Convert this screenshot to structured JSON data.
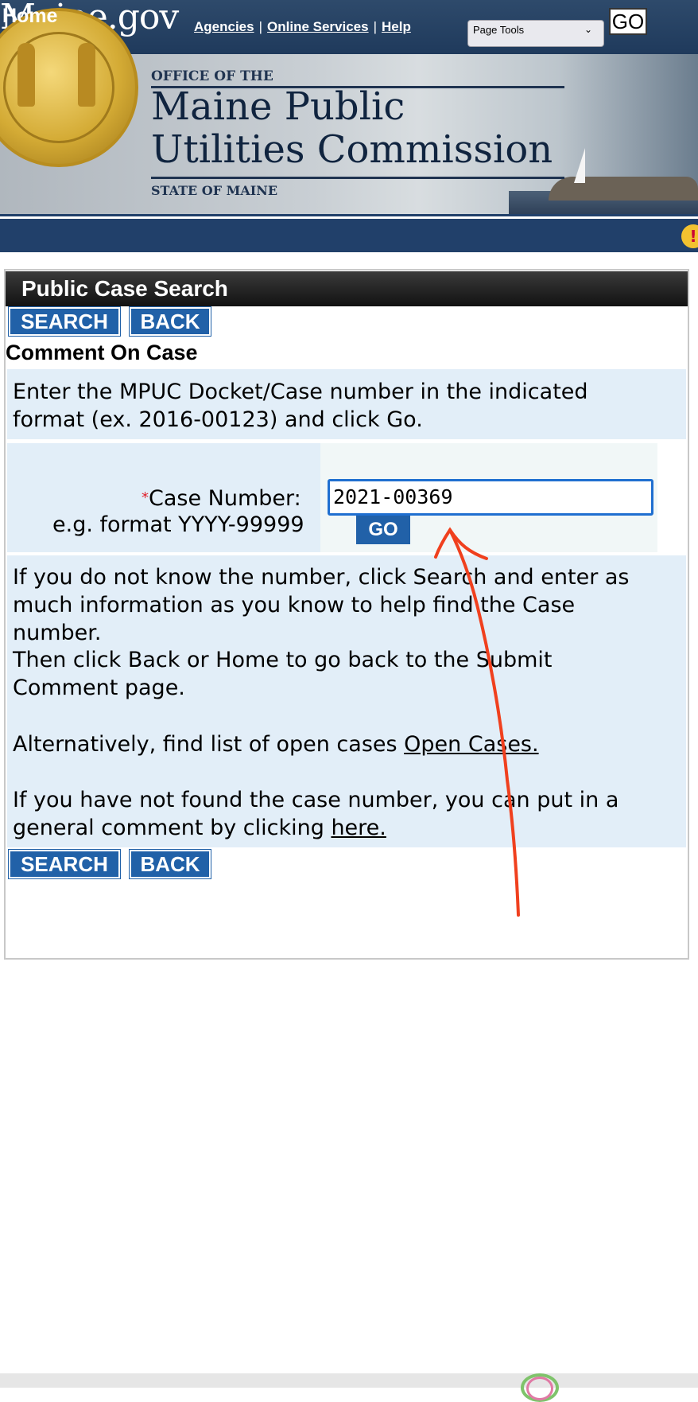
{
  "header": {
    "logo": "Maine.gov",
    "links": [
      "Agencies",
      "Online Services",
      "Help"
    ],
    "page_tools_value": "Page Tools",
    "go_label": "GO"
  },
  "banner": {
    "office_line": "OFFICE OF THE",
    "title_line1": "Maine Public",
    "title_line2": "Utilities Commission",
    "state_line": "STATE OF MAINE"
  },
  "nav": {
    "home": "Home"
  },
  "panel": {
    "title": "Public Case Search",
    "search_label": "SEARCH",
    "back_label": "BACK",
    "subtitle": "Comment On Case",
    "instructions_line1": "Enter the MPUC Docket/Case number in the indicated",
    "instructions_line2": "format (ex. 2016-00123) and click Go.",
    "form": {
      "required_mark": "*",
      "case_number_label": "Case Number:",
      "format_hint": "e.g. format YYYY-99999",
      "case_number_value": "2021-00369",
      "go_label": "GO"
    },
    "help": {
      "line1": "If you do not know the number, click Search and enter as",
      "line2": "much information as you know to help find the Case",
      "line3": "number.",
      "line4": "Then click Back or Home to go back to the Submit",
      "line5": "Comment page.",
      "alt_prefix": "Alternatively, find list of open cases ",
      "alt_link": "Open Cases.",
      "general_line1": "If you have not found the case number, you can put in a",
      "general_prefix": "general comment by clicking ",
      "general_link": "here."
    }
  },
  "colors": {
    "header_blue": "#21406a",
    "button_blue": "#2161a8",
    "info_box": "#e2eef8",
    "annotation_arrow": "#f0401e",
    "input_focus": "#1f6fd0"
  },
  "icons": [
    "alert-icon",
    "chevron-down-icon",
    "state-seal-icon"
  ]
}
